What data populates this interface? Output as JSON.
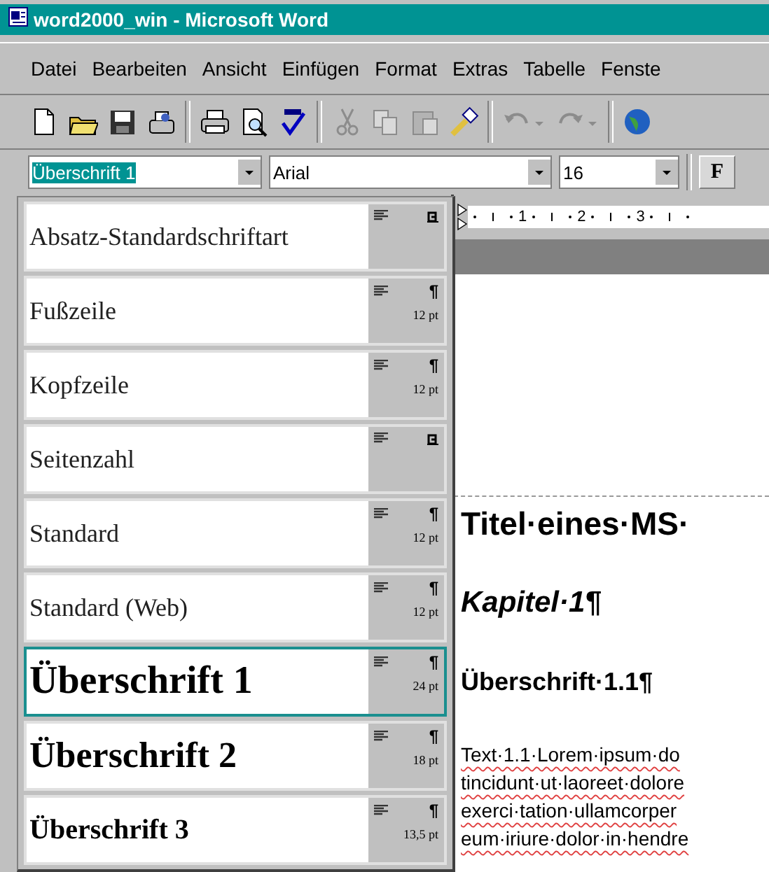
{
  "window": {
    "title": "word2000_win - Microsoft Word"
  },
  "menu": [
    {
      "label": "Datei"
    },
    {
      "label": "Bearbeiten"
    },
    {
      "label": "Ansicht"
    },
    {
      "label": "Einfügen"
    },
    {
      "label": "Format"
    },
    {
      "label": "Extras"
    },
    {
      "label": "Tabelle"
    },
    {
      "label": "Fenste"
    }
  ],
  "toolbar": [
    {
      "kind": "new",
      "disabled": false
    },
    {
      "kind": "open",
      "disabled": false
    },
    {
      "kind": "save",
      "disabled": false
    },
    {
      "kind": "mail",
      "disabled": false
    },
    {
      "kind": "separator"
    },
    {
      "kind": "print",
      "disabled": false
    },
    {
      "kind": "preview",
      "disabled": false
    },
    {
      "kind": "spelling",
      "disabled": false
    },
    {
      "kind": "separator"
    },
    {
      "kind": "cut",
      "disabled": true
    },
    {
      "kind": "copy",
      "disabled": true
    },
    {
      "kind": "paste",
      "disabled": true
    },
    {
      "kind": "painter",
      "disabled": false
    },
    {
      "kind": "separator"
    },
    {
      "kind": "undo",
      "disabled": true
    },
    {
      "kind": "redo",
      "disabled": true
    },
    {
      "kind": "separator"
    },
    {
      "kind": "globe",
      "disabled": false
    }
  ],
  "formatting": {
    "style": "Überschrift 1",
    "font": "Arial",
    "size": "16",
    "bold": "F"
  },
  "style_list": [
    {
      "name": "Absatz-Standardschriftart",
      "kind": "plain",
      "selected": false
    },
    {
      "name": "Fußzeile",
      "kind": "plain",
      "mark": "¶",
      "size": "12 pt",
      "selected": false
    },
    {
      "name": "Kopfzeile",
      "kind": "plain",
      "mark": "¶",
      "size": "12 pt",
      "selected": false
    },
    {
      "name": "Seitenzahl",
      "kind": "plain",
      "selected": false
    },
    {
      "name": "Standard",
      "kind": "plain",
      "mark": "¶",
      "size": "12 pt",
      "selected": false
    },
    {
      "name": "Standard (Web)",
      "kind": "plain",
      "mark": "¶",
      "size": "12 pt",
      "selected": false
    },
    {
      "name": "Überschrift 1",
      "kind": "h1",
      "mark": "¶",
      "size": "24 pt",
      "selected": true
    },
    {
      "name": "Überschrift 2",
      "kind": "h2",
      "mark": "¶",
      "size": "18 pt",
      "selected": false
    },
    {
      "name": "Überschrift 3",
      "kind": "h3",
      "mark": "¶",
      "size": "13,5 pt",
      "selected": false
    }
  ],
  "ruler": {
    "labels": [
      "1",
      "2",
      "3"
    ]
  },
  "document": {
    "paragraphs": [
      {
        "kind": "title",
        "text": "Titel·eines·MS·"
      },
      {
        "kind": "chapter",
        "text": "Kapitel·1¶"
      },
      {
        "kind": "heading",
        "text": "Überschrift·1.1¶"
      },
      {
        "kind": "body",
        "lines": [
          "Text·1.1·Lorem·ipsum·do",
          "tincidunt·ut·laoreet·dolore",
          "exerci·tation·ullamcorper",
          "eum·iriure·dolor·in·hendre"
        ]
      }
    ]
  }
}
